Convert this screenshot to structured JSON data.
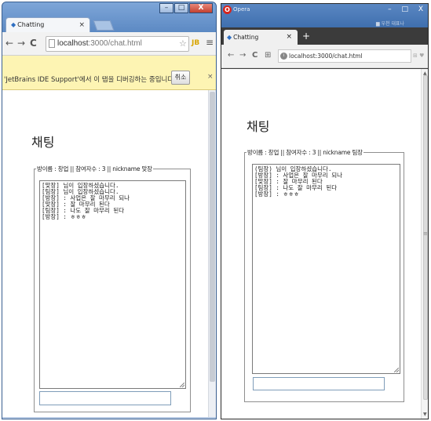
{
  "chrome": {
    "window_buttons": [
      "–",
      "□",
      "X"
    ],
    "tab_title": "Chatting",
    "tab_close": "×",
    "nav": {
      "back": "←",
      "forward": "→",
      "reload": "C"
    },
    "url_host": "localhost",
    "url_path": ":3000/chat.html",
    "star": "☆",
    "ext": "JB",
    "menu": "≡",
    "infobar": {
      "message": "'JetBrains IDE Support'에서 이 탭을 디버깅하는 중입니다.",
      "cancel_label": "취소",
      "close": "×"
    },
    "page": {
      "title": "채팅",
      "legend": "방이름 : 창업 || 참여자수 : 3 || nickname 맞장",
      "chat_lines": [
        "[맞장] 님이 입장하셨습니다.",
        "[팀장] 님이 입장하셨습니다.",
        "[방장] : 사업은 잘 마무리 되나",
        "[맞장] : 잘 마무리 된다",
        "[팀장] : 나도 잘 마무리 된다",
        "[방장] : ㅎㅎㅎ"
      ],
      "input_value": ""
    }
  },
  "opera": {
    "app_name": "Opera",
    "window_buttons": [
      "–",
      "□",
      "X"
    ],
    "tab_title": "Chatting",
    "tab_close": "×",
    "new_tab": "+",
    "blurred_text": "▆ 우천 대표나",
    "nav": {
      "back": "←",
      "forward": "→",
      "reload": "C",
      "grid": "⊞"
    },
    "url": "localhost:3000/chat.html",
    "right_icons": "⊞ ♥",
    "page": {
      "title": "채팅",
      "legend": "방이름 : 창업 || 참여자수 : 3 || nickname 팀장",
      "chat_lines": [
        "(팀장) 님이 입장하셨습니다.",
        "[방장] : 사업은 잘 마무리 되나",
        "[맞장] : 잘 마무리 된다",
        "[팀장] : 나도 잘 마무리 된다",
        "[방장] : ㅎㅎㅎ"
      ],
      "input_value": ""
    }
  }
}
